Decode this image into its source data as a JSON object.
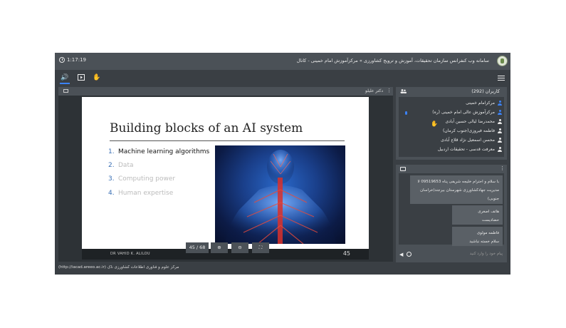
{
  "header": {
    "clock": "1:17:19",
    "title": "سامانه وب کنفرانس سازمان تحقیقات، آموزش و ترویج کشاورزی » مرکزآموزش امام خمینی - کانال"
  },
  "presentation": {
    "presenter_label": "دکتر علیلو",
    "slide": {
      "title": "Building blocks of an AI system",
      "bullets": [
        {
          "num": "1.",
          "text": "Machine learning algorithms"
        },
        {
          "num": "2.",
          "text": "Data"
        },
        {
          "num": "3.",
          "text": "Computing power"
        },
        {
          "num": "4.",
          "text": "Human expertise"
        }
      ],
      "footer_author": "DR VAHID K. ALILOU",
      "page_number": "45"
    },
    "controls": {
      "page_counter": "45 / 68",
      "zoom_in": "⊕",
      "zoom_out": "⊖",
      "fullscreen": "⛶"
    }
  },
  "users": {
    "title": "کاربران (292)",
    "list": [
      {
        "name": "مرکزامام خمینی",
        "color": "#3b82f6"
      },
      {
        "name": "مرکزآموزش عالی امام خمینی (ره)",
        "color": "#3b82f6"
      },
      {
        "name": "محمدرضا لیالی حسین آبادی",
        "color": "#e8e8e8"
      },
      {
        "name": "فاطمه فیروزی(جنوب کرمان)",
        "color": "#e8e8e8"
      },
      {
        "name": "محسن اسمعیل نژاد قلاع آبادی",
        "color": "#e8e8e8"
      },
      {
        "name": "معرفت قدسی - تحقیقات اردبیل",
        "color": "#e8e8e8"
      }
    ]
  },
  "chat": {
    "messages": [
      {
        "lines": [
          "با سلام و احترام خلیجه شریفی پناه 09519653 لا",
          "مدیریت جهادکشاورزی شهرستان بیرجند(خراسان",
          "جنوبی)"
        ]
      },
      {
        "lines": [
          "هاتف اصغری",
          "حضادیست"
        ]
      },
      {
        "lines": [
          "فاطمه مولوی",
          "سلام خسته نباشید"
        ]
      }
    ],
    "placeholder": "پیام خود را وارد کنید"
  },
  "status_bar": "(http://iacad.areeo.ac.ir) مرکز علوم و فناوری اطلاعات کشاورزی ناک",
  "icons": {
    "speaker": "speaker-icon",
    "screen_share": "screen-share-icon",
    "raise_hand": "raise-hand-icon",
    "menu": "hamburger-menu-icon"
  }
}
